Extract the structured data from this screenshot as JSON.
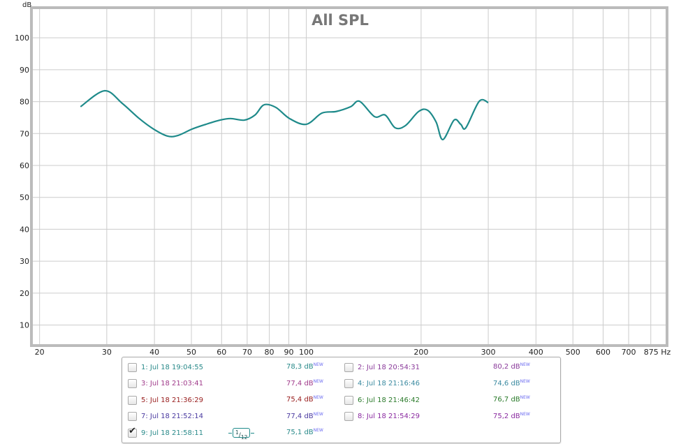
{
  "chart_data": {
    "type": "line",
    "title": "All SPL",
    "ylabel": "dB",
    "xlabel": "Hz",
    "xscale": "log",
    "xlim": [
      19.2,
      875
    ],
    "ylim": [
      4,
      109
    ],
    "grid": true,
    "yticks": [
      10,
      20,
      30,
      40,
      50,
      60,
      70,
      80,
      90,
      100
    ],
    "xticks": [
      20,
      30,
      40,
      50,
      60,
      70,
      80,
      90,
      100,
      200,
      300,
      400,
      500,
      600,
      700,
      800
    ],
    "xtick_labels": [
      "20",
      "30",
      "40",
      "50",
      "60",
      "70",
      "80",
      "90",
      "100",
      "200",
      "300",
      "400",
      "500",
      "600",
      "700",
      "",
      "875 Hz"
    ],
    "series": [
      {
        "name": "9: Jul 18 21:58:11",
        "color": "#1e8a8a",
        "x": [
          25.6,
          29.6,
          32.9,
          36.5,
          39.8,
          43.3,
          46.1,
          50.2,
          54.6,
          59.4,
          63.3,
          68.8,
          73.4,
          77.5,
          83.2,
          90.4,
          100,
          109.9,
          119.7,
          130.7,
          138,
          151,
          161,
          171,
          182,
          197,
          208,
          219,
          228,
          244,
          254,
          262,
          284,
          300
        ],
        "y": [
          78.4,
          83.4,
          79.5,
          74.7,
          71.4,
          69.2,
          69.4,
          71.4,
          72.9,
          74.2,
          74.7,
          74.2,
          75.8,
          79.0,
          78.2,
          74.7,
          72.9,
          76.4,
          76.9,
          78.4,
          80.1,
          75.3,
          75.8,
          71.8,
          72.5,
          76.9,
          77.3,
          73.6,
          68.1,
          74.2,
          72.9,
          71.8,
          80.1,
          79.7
        ]
      }
    ]
  },
  "legend": {
    "items": [
      {
        "label": "1: Jul 18 19:04:55",
        "value": "78,3 dB",
        "badge": "NEW",
        "color": "#2a8a8a",
        "checked": false
      },
      {
        "label": "2: Jul 18 20:54:31",
        "value": "80,2 dB",
        "badge": "NEW",
        "color": "#8a3a9a",
        "checked": false
      },
      {
        "label": "3: Jul 18 21:03:41",
        "value": "77,4 dB",
        "badge": "NEW",
        "color": "#a03a8a",
        "checked": false
      },
      {
        "label": "4: Jul 18 21:16:46",
        "value": "74,6 dB",
        "badge": "NEW",
        "color": "#3a8aa0",
        "checked": false
      },
      {
        "label": "5: Jul 18 21:36:29",
        "value": "75,4 dB",
        "badge": "NEW",
        "color": "#9a2020",
        "checked": false
      },
      {
        "label": "6: Jul 18 21:46:42",
        "value": "76,7 dB",
        "badge": "NEW",
        "color": "#2a7a2a",
        "checked": false
      },
      {
        "label": "7: Jul 18 21:52:14",
        "value": "77,4 dB",
        "badge": "NEW",
        "color": "#4a3aa0",
        "checked": false
      },
      {
        "label": "8: Jul 18 21:54:29",
        "value": "75,2 dB",
        "badge": "NEW",
        "color": "#8a2aa0",
        "checked": false
      },
      {
        "label": "9: Jul 18 21:58:11",
        "value": "75,1 dB",
        "badge": "NEW",
        "color": "#2a8a8a",
        "checked": true
      }
    ],
    "smoothing": {
      "num": "1",
      "den": "12"
    }
  }
}
